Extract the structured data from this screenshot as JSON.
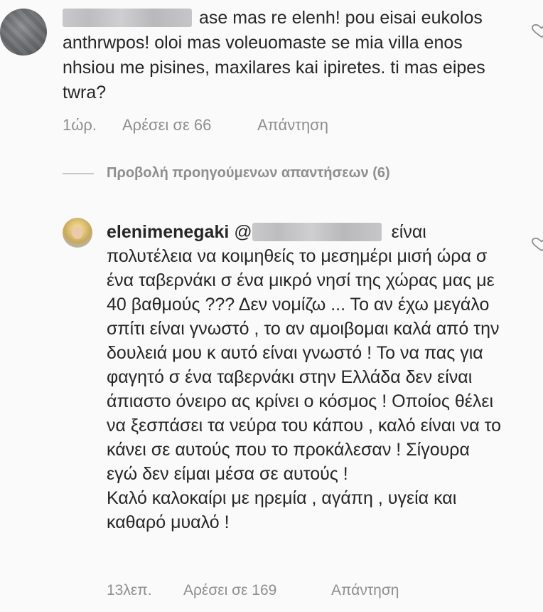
{
  "comment1": {
    "text": "ase mas re elenh! pou eisai eukolos anthrwpos! oloi mas voleuomaste se mia villa enos nhsiou me pisines, maxilares kai ipiretes. ti mas eipes twra?",
    "time": "1ώρ.",
    "likes": "Αρέσει σε 66",
    "reply": "Απάντηση"
  },
  "view_previous": "Προβολή προηγούμενων απαντήσεων (6)",
  "comment2": {
    "username": "elenimenegaki",
    "mention_prefix": "@",
    "text_first": "είναι πολυτέλεια να κοιμηθείς το μεσημέρι μισή ώρα  σ ένα ταβερνάκι σ ένα μικρό νησί της χώρας μας με 40 βαθμούς ??? Δεν νομίζω ... Το αν έχω μεγάλο σπίτι είναι γνωστό , το αν αμοιβομαι καλά από την δουλειά μου κ αυτό είναι γνωστό ! Το να πας για φαγητό σ ένα ταβερνάκι στην Ελλάδα δεν είναι άπιαστο όνειρο ας κρίνει ο κόσμος ! Οποίος θέλει να ξεσπάσει τα νεύρα του κάπου , καλό είναι να το κάνει σε αυτούς που το προκάλεσαν !  Σίγουρα εγώ δεν είμαι μέσα σε αυτούς !",
    "text_second": "Καλό καλοκαίρι με ηρεμία , αγάπη , υγεία και καθαρό μυαλό !",
    "time": "13λεπ.",
    "likes": "Αρέσει σε 169",
    "reply": "Απάντηση"
  },
  "icons": {
    "like": "heart-icon"
  },
  "colors": {
    "text": "#262626",
    "secondary": "#8e8e8e",
    "background": "#fafafa"
  }
}
